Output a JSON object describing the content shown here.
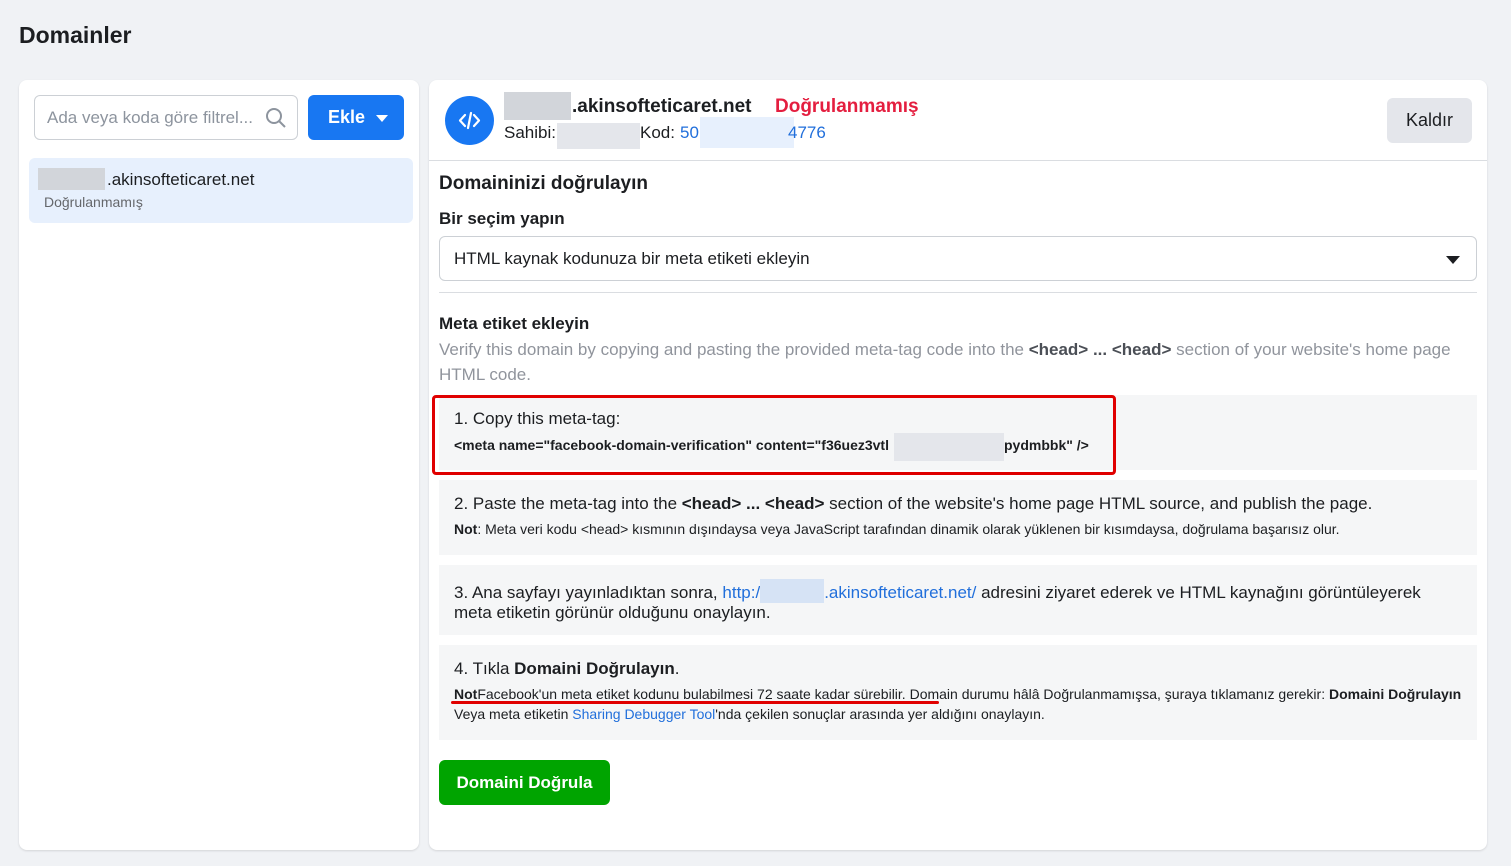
{
  "page": {
    "title": "Domainler"
  },
  "sidebar": {
    "search_placeholder": "Ada veya koda göre filtrel...",
    "add_label": "Ekle",
    "items": [
      {
        "name": ".akinsofteticaret.net",
        "status": "Doğrulanmamış"
      }
    ]
  },
  "detail": {
    "domain_name": ".akinsofteticaret.net",
    "status": "Doğrulanmamış",
    "owner_label": "Sahibi:",
    "code_label": "Kod:",
    "code_start": "50",
    "code_end": "4776",
    "remove_label": "Kaldır",
    "verify_title": "Domaininizi doğrulayın",
    "select_label": "Bir seçim yapın",
    "select_value": "HTML kaynak kodunuza bir meta etiketi ekleyin",
    "meta_title": "Meta etiket ekleyin",
    "meta_desc_1": "Verify this domain by copying and pasting the provided meta-tag code into the ",
    "meta_desc_head1": "<head> ... <head>",
    "meta_desc_2": " section of your website's home page HTML code.",
    "step1": {
      "text": "1. Copy this meta-tag:",
      "code_a": "<meta name=\"facebook-domain-verification\" content=\"f36uez3vtl",
      "code_b": "pydmbbk\" />"
    },
    "step2": {
      "text_1": "2. Paste the meta-tag into the ",
      "head": "<head> ... <head>",
      "text_2": " section of the website's home page HTML source, and publish the page.",
      "note_label": "Not",
      "note_text": ": Meta veri kodu <head> kısmının dışındaysa veya JavaScript tarafından dinamik olarak yüklenen bir kısımdaysa, doğrulama başarısız olur."
    },
    "step3": {
      "text_1": "3. Ana sayfayı yayınladıktan sonra, ",
      "link_a": "http:/",
      "link_b": ".akinsofteticaret.net/",
      "text_2": " adresini ziyaret ederek ve HTML kaynağını görüntüleyerek meta etiketin görünür olduğunu onaylayın."
    },
    "step4": {
      "text_1": "4. Tıkla ",
      "bold": "Domaini Doğrulayın",
      "text_2": ".",
      "note_label": "Not",
      "note_text_1": "Facebook'un meta etiket kodunu bulabilmesi 72 saate kadar sürebilir. Domain durumu hâlâ Doğrulanmamışsa, şuraya tıklamanız gerekir: ",
      "note_bold": "Domaini Doğrulayın",
      "note_text_2": " Veya meta etiketin ",
      "note_link": "Sharing Debugger Tool",
      "note_text_3": "'nda çekilen sonuçlar arasında yer aldığını onaylayın."
    },
    "verify_button": "Domaini Doğrula"
  },
  "colors": {
    "accent": "#1877f2",
    "danger": "#e41e3f",
    "success": "#00a400",
    "link": "#216fdb"
  }
}
